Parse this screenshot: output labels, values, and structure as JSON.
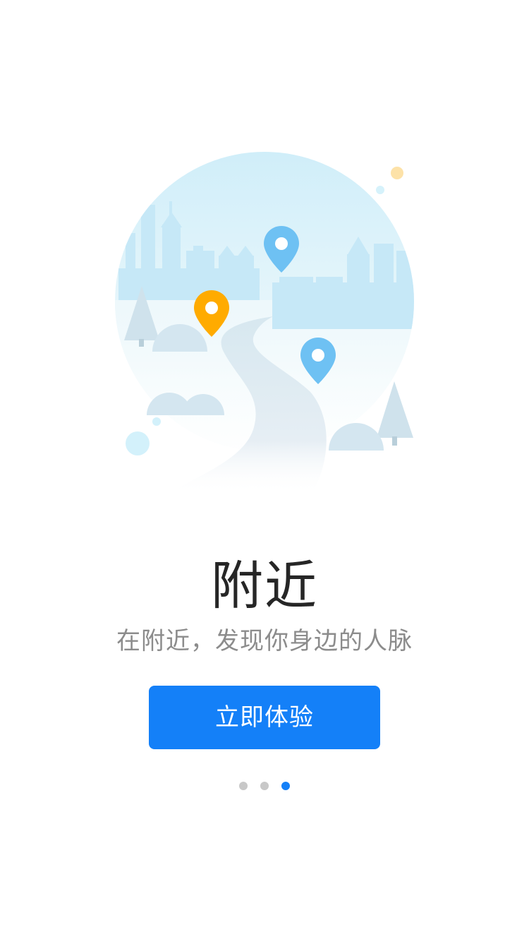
{
  "onboarding": {
    "title": "附近",
    "subtitle": "在附近，发现你身边的人脉",
    "cta_label": "立即体验",
    "page_indicator": {
      "total": 3,
      "current": 3
    }
  },
  "illustration": {
    "icons": [
      "city-skyline-icon",
      "map-pin-icon",
      "road-icon",
      "tree-icon",
      "bush-icon"
    ]
  },
  "colors": {
    "accent": "#1480f8",
    "pin_orange": "#ffab00",
    "pin_blue": "#6ec1f3",
    "circle_sky": "#d3eff9",
    "inactive_dot": "#c8c8c8"
  }
}
